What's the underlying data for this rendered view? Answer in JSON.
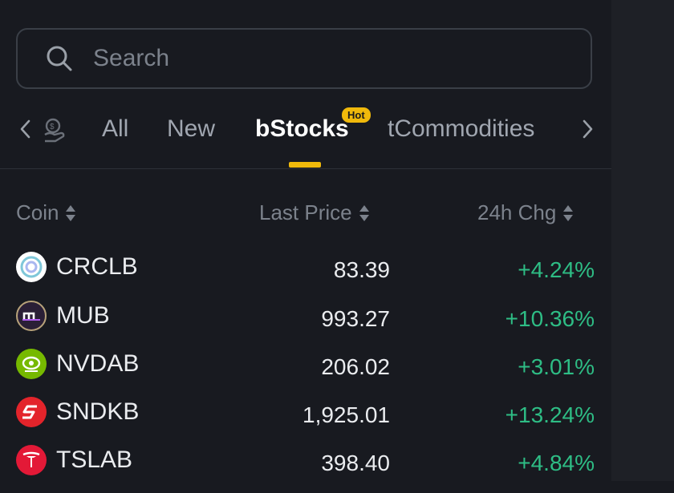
{
  "search": {
    "placeholder": "Search"
  },
  "tabs": {
    "items": [
      {
        "label": "All"
      },
      {
        "label": "New"
      },
      {
        "label": "bStocks",
        "badge": "Hot",
        "active": true
      },
      {
        "label": "tCommodities"
      }
    ]
  },
  "table": {
    "headers": {
      "coin": "Coin",
      "price": "Last Price",
      "change": "24h Chg"
    },
    "rows": [
      {
        "symbol": "CRCLB",
        "price": "83.39",
        "change": "+4.24%",
        "icon": "circle-logo-icon"
      },
      {
        "symbol": "MUB",
        "price": "993.27",
        "change": "+10.36%",
        "icon": "micron-logo-icon"
      },
      {
        "symbol": "NVDAB",
        "price": "206.02",
        "change": "+3.01%",
        "icon": "nvidia-logo-icon"
      },
      {
        "symbol": "SNDKB",
        "price": "1,925.01",
        "change": "+13.24%",
        "icon": "sandisk-logo-icon"
      },
      {
        "symbol": "TSLAB",
        "price": "398.40",
        "change": "+4.84%",
        "icon": "tesla-logo-icon"
      }
    ]
  },
  "colors": {
    "background": "#181a20",
    "accent": "#f0b90b",
    "positive": "#2ebd85",
    "muted_text": "#7c828c"
  }
}
